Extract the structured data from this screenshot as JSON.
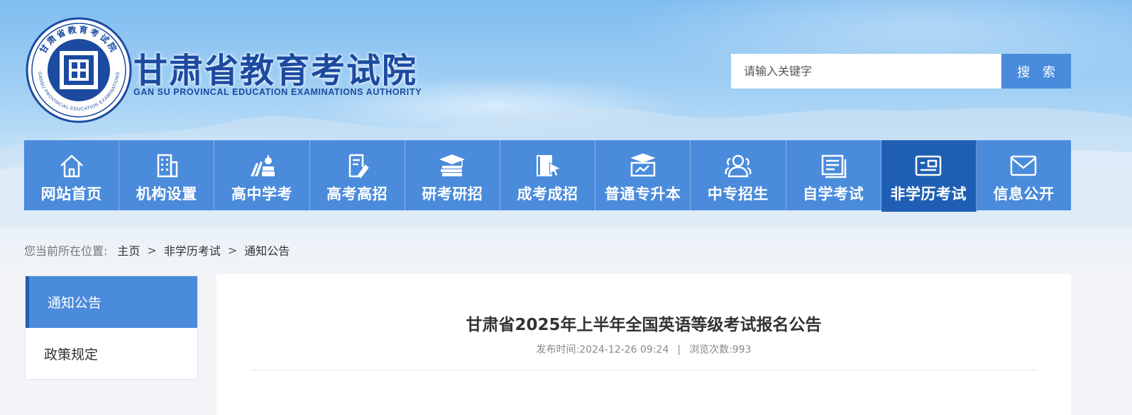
{
  "header": {
    "logo_cn": "甘肃省教育考试院",
    "logo_en": "GAN SU PROVINCAL EDUCATION EXAMINATIONS AUTHORITY",
    "seal_center": "囯",
    "seal_ring_top": "甘肃省教育考试院",
    "seal_ring_bottom": "GANSU PROVINCIAL EDUCATION EXAMINATIONS"
  },
  "search": {
    "placeholder": "请输入关键字",
    "button_label": "搜 索"
  },
  "nav": {
    "items": [
      {
        "label": "网站首页",
        "icon": "home-icon"
      },
      {
        "label": "机构设置",
        "icon": "building-icon"
      },
      {
        "label": "高中学考",
        "icon": "books-icon"
      },
      {
        "label": "高考高招",
        "icon": "document-pen-icon"
      },
      {
        "label": "研考研招",
        "icon": "graduation-cap-icon"
      },
      {
        "label": "成考成招",
        "icon": "book-cursor-icon"
      },
      {
        "label": "普通专升本",
        "icon": "presentation-icon"
      },
      {
        "label": "中专招生",
        "icon": "users-icon"
      },
      {
        "label": "自学考试",
        "icon": "document-stack-icon"
      },
      {
        "label": "非学历考试",
        "icon": "id-card-icon"
      },
      {
        "label": "信息公开",
        "icon": "mail-icon"
      }
    ],
    "active_index": 9
  },
  "breadcrumb": {
    "prefix": "您当前所在位置:",
    "items": [
      "主页",
      "非学历考试",
      "通知公告"
    ],
    "separator": ">"
  },
  "sidebar": {
    "items": [
      {
        "label": "通知公告",
        "active": true
      },
      {
        "label": "政策规定",
        "active": false
      }
    ]
  },
  "article": {
    "title": "甘肃省2025年上半年全国英语等级考试报名公告",
    "publish_label": "发布时间:",
    "publish_time": "2024-12-26 09:24",
    "meta_separator": "|",
    "views_label": "浏览次数:",
    "views": "993"
  },
  "colors": {
    "nav_blue": "#4a8bdb",
    "nav_active": "#1e5fb3",
    "logo_blue": "#1c4aa0",
    "search_button": "#4b8bdc"
  }
}
